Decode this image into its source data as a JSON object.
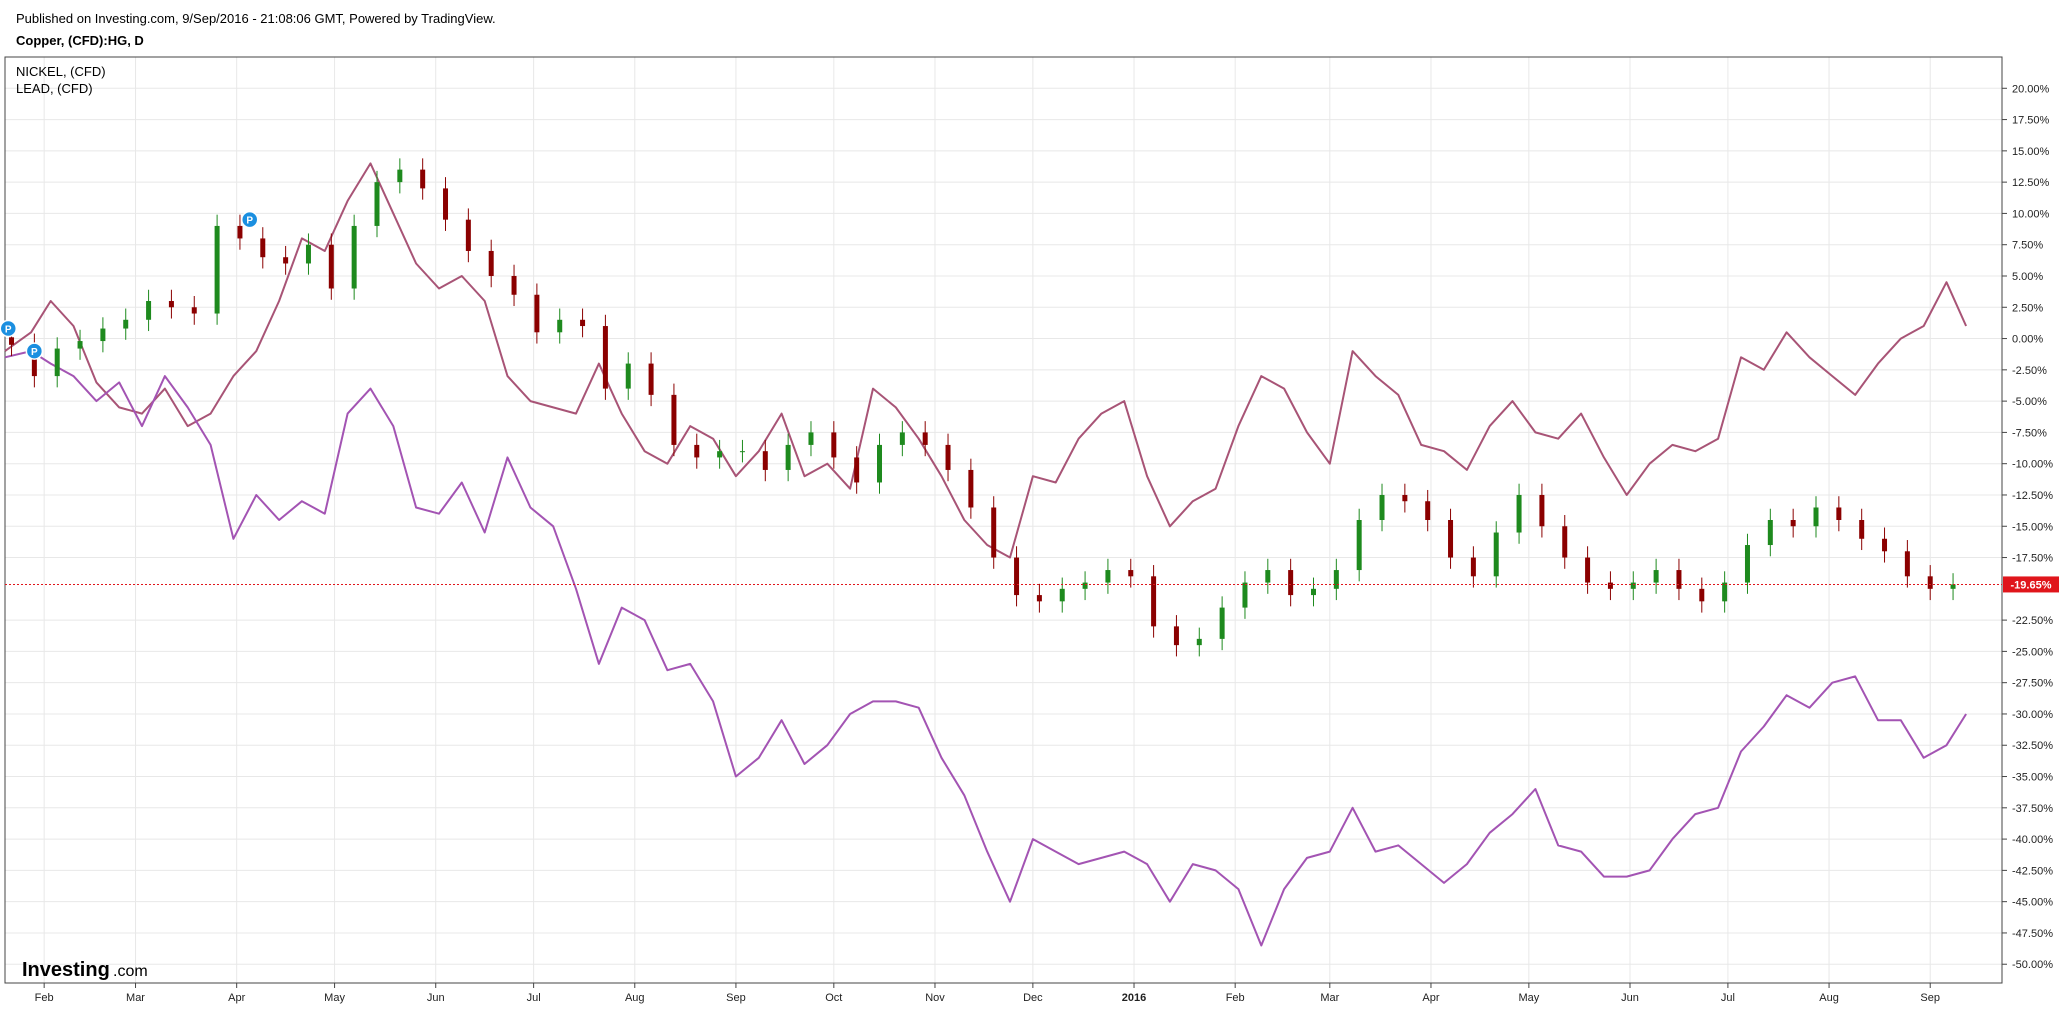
{
  "header": {
    "published": "Published on Investing.com, 9/Sep/2016 - 21:08:06 GMT, Powered by TradingView.",
    "symbol": "Copper, (CFD):HG, D"
  },
  "legend": [
    "NICKEL,  (CFD)",
    "LEAD,  (CFD)"
  ],
  "logo": {
    "main": "Investing",
    "suffix": ".com"
  },
  "markers": {
    "label": "P"
  },
  "colors": {
    "nickel": "#a85476",
    "lead": "#a354b3",
    "up": "#1e8a1e",
    "down": "#8b0000",
    "current": "#e0151b",
    "grid": "#e8e8e8"
  },
  "chart_data": {
    "type": "line",
    "ylim": [
      -51.5,
      22.5
    ],
    "y_ticks": [
      "20.00%",
      "17.50%",
      "15.00%",
      "12.50%",
      "10.00%",
      "7.50%",
      "5.00%",
      "2.50%",
      "0.00%",
      "-2.50%",
      "-5.00%",
      "-7.50%",
      "-10.00%",
      "-12.50%",
      "-15.00%",
      "-17.50%",
      "-22.50%",
      "-25.00%",
      "-27.50%",
      "-30.00%",
      "-32.50%",
      "-35.00%",
      "-37.50%",
      "-40.00%",
      "-42.50%",
      "-45.00%",
      "-47.50%",
      "-50.00%"
    ],
    "x_ticks": [
      "Feb",
      "Mar",
      "Apr",
      "May",
      "Jun",
      "Jul",
      "Aug",
      "Sep",
      "Oct",
      "Nov",
      "Dec",
      "2016",
      "Feb",
      "Mar",
      "Apr",
      "May",
      "Jun",
      "Jul",
      "Aug",
      "Sep"
    ],
    "current_value_label": "-19.65%",
    "current_value": -19.65,
    "x_range": [
      "2015-01-20",
      "2016-09-23"
    ],
    "series": [
      {
        "name": "Copper, (CFD):HG, D",
        "kind": "candles",
        "points": [
          [
            "2015-01-22",
            -0.5
          ],
          [
            "2015-01-29",
            -3.0
          ],
          [
            "2015-02-05",
            -0.8
          ],
          [
            "2015-02-12",
            -0.2
          ],
          [
            "2015-02-19",
            0.8
          ],
          [
            "2015-02-26",
            1.5
          ],
          [
            "2015-03-05",
            3.0
          ],
          [
            "2015-03-12",
            2.5
          ],
          [
            "2015-03-19",
            2.0
          ],
          [
            "2015-03-26",
            9.0
          ],
          [
            "2015-04-02",
            8.0
          ],
          [
            "2015-04-09",
            6.5
          ],
          [
            "2015-04-16",
            6.0
          ],
          [
            "2015-04-23",
            7.5
          ],
          [
            "2015-04-30",
            4.0
          ],
          [
            "2015-05-07",
            9.0
          ],
          [
            "2015-05-14",
            12.5
          ],
          [
            "2015-05-21",
            13.5
          ],
          [
            "2015-05-28",
            12.0
          ],
          [
            "2015-06-04",
            9.5
          ],
          [
            "2015-06-11",
            7.0
          ],
          [
            "2015-06-18",
            5.0
          ],
          [
            "2015-06-25",
            3.5
          ],
          [
            "2015-07-02",
            0.5
          ],
          [
            "2015-07-09",
            1.5
          ],
          [
            "2015-07-16",
            1.0
          ],
          [
            "2015-07-23",
            -4.0
          ],
          [
            "2015-07-30",
            -2.0
          ],
          [
            "2015-08-06",
            -4.5
          ],
          [
            "2015-08-13",
            -8.5
          ],
          [
            "2015-08-20",
            -9.5
          ],
          [
            "2015-08-27",
            -9.0
          ],
          [
            "2015-09-03",
            -9.0
          ],
          [
            "2015-09-10",
            -10.5
          ],
          [
            "2015-09-17",
            -8.5
          ],
          [
            "2015-09-24",
            -7.5
          ],
          [
            "2015-10-01",
            -9.5
          ],
          [
            "2015-10-08",
            -11.5
          ],
          [
            "2015-10-15",
            -8.5
          ],
          [
            "2015-10-22",
            -7.5
          ],
          [
            "2015-10-29",
            -8.5
          ],
          [
            "2015-11-05",
            -10.5
          ],
          [
            "2015-11-12",
            -13.5
          ],
          [
            "2015-11-19",
            -17.5
          ],
          [
            "2015-11-26",
            -20.5
          ],
          [
            "2015-12-03",
            -21.0
          ],
          [
            "2015-12-10",
            -20.0
          ],
          [
            "2015-12-17",
            -19.5
          ],
          [
            "2015-12-24",
            -18.5
          ],
          [
            "2015-12-31",
            -19.0
          ],
          [
            "2016-01-07",
            -23.0
          ],
          [
            "2016-01-14",
            -24.5
          ],
          [
            "2016-01-21",
            -24.0
          ],
          [
            "2016-01-28",
            -21.5
          ],
          [
            "2016-02-04",
            -19.5
          ],
          [
            "2016-02-11",
            -18.5
          ],
          [
            "2016-02-18",
            -20.5
          ],
          [
            "2016-02-25",
            -20.0
          ],
          [
            "2016-03-03",
            -18.5
          ],
          [
            "2016-03-10",
            -14.5
          ],
          [
            "2016-03-17",
            -12.5
          ],
          [
            "2016-03-24",
            -13.0
          ],
          [
            "2016-03-31",
            -14.5
          ],
          [
            "2016-04-07",
            -17.5
          ],
          [
            "2016-04-14",
            -19.0
          ],
          [
            "2016-04-21",
            -15.5
          ],
          [
            "2016-04-28",
            -12.5
          ],
          [
            "2016-05-05",
            -15.0
          ],
          [
            "2016-05-12",
            -17.5
          ],
          [
            "2016-05-19",
            -19.5
          ],
          [
            "2016-05-26",
            -20.0
          ],
          [
            "2016-06-02",
            -19.5
          ],
          [
            "2016-06-09",
            -18.5
          ],
          [
            "2016-06-16",
            -20.0
          ],
          [
            "2016-06-23",
            -21.0
          ],
          [
            "2016-06-30",
            -19.5
          ],
          [
            "2016-07-07",
            -16.5
          ],
          [
            "2016-07-14",
            -14.5
          ],
          [
            "2016-07-21",
            -15.0
          ],
          [
            "2016-07-28",
            -13.5
          ],
          [
            "2016-08-04",
            -14.5
          ],
          [
            "2016-08-11",
            -16.0
          ],
          [
            "2016-08-18",
            -17.0
          ],
          [
            "2016-08-25",
            -19.0
          ],
          [
            "2016-09-01",
            -20.0
          ],
          [
            "2016-09-08",
            -19.65
          ]
        ]
      },
      {
        "name": "NICKEL,  (CFD)",
        "kind": "line",
        "points": [
          [
            "2015-01-20",
            -1.0
          ],
          [
            "2015-01-28",
            0.5
          ],
          [
            "2015-02-03",
            3.0
          ],
          [
            "2015-02-10",
            1.0
          ],
          [
            "2015-02-17",
            -3.5
          ],
          [
            "2015-02-24",
            -5.5
          ],
          [
            "2015-03-03",
            -6.0
          ],
          [
            "2015-03-10",
            -4.0
          ],
          [
            "2015-03-17",
            -7.0
          ],
          [
            "2015-03-24",
            -6.0
          ],
          [
            "2015-03-31",
            -3.0
          ],
          [
            "2015-04-07",
            -1.0
          ],
          [
            "2015-04-14",
            3.0
          ],
          [
            "2015-04-21",
            8.0
          ],
          [
            "2015-04-28",
            7.0
          ],
          [
            "2015-05-05",
            11.0
          ],
          [
            "2015-05-12",
            14.0
          ],
          [
            "2015-05-19",
            10.0
          ],
          [
            "2015-05-26",
            6.0
          ],
          [
            "2015-06-02",
            4.0
          ],
          [
            "2015-06-09",
            5.0
          ],
          [
            "2015-06-16",
            3.0
          ],
          [
            "2015-06-23",
            -3.0
          ],
          [
            "2015-06-30",
            -5.0
          ],
          [
            "2015-07-07",
            -5.5
          ],
          [
            "2015-07-14",
            -6.0
          ],
          [
            "2015-07-21",
            -2.0
          ],
          [
            "2015-07-28",
            -6.0
          ],
          [
            "2015-08-04",
            -9.0
          ],
          [
            "2015-08-11",
            -10.0
          ],
          [
            "2015-08-18",
            -7.0
          ],
          [
            "2015-08-25",
            -8.0
          ],
          [
            "2015-09-01",
            -11.0
          ],
          [
            "2015-09-08",
            -9.0
          ],
          [
            "2015-09-15",
            -6.0
          ],
          [
            "2015-09-22",
            -11.0
          ],
          [
            "2015-09-29",
            -10.0
          ],
          [
            "2015-10-06",
            -12.0
          ],
          [
            "2015-10-13",
            -4.0
          ],
          [
            "2015-10-20",
            -5.5
          ],
          [
            "2015-10-27",
            -8.0
          ],
          [
            "2015-11-03",
            -11.0
          ],
          [
            "2015-11-10",
            -14.5
          ],
          [
            "2015-11-17",
            -16.5
          ],
          [
            "2015-11-24",
            -17.5
          ],
          [
            "2015-12-01",
            -11.0
          ],
          [
            "2015-12-08",
            -11.5
          ],
          [
            "2015-12-15",
            -8.0
          ],
          [
            "2015-12-22",
            -6.0
          ],
          [
            "2015-12-29",
            -5.0
          ],
          [
            "2016-01-05",
            -11.0
          ],
          [
            "2016-01-12",
            -15.0
          ],
          [
            "2016-01-19",
            -13.0
          ],
          [
            "2016-01-26",
            -12.0
          ],
          [
            "2016-02-02",
            -7.0
          ],
          [
            "2016-02-09",
            -3.0
          ],
          [
            "2016-02-16",
            -4.0
          ],
          [
            "2016-02-23",
            -7.5
          ],
          [
            "2016-03-01",
            -10.0
          ],
          [
            "2016-03-08",
            -1.0
          ],
          [
            "2016-03-15",
            -3.0
          ],
          [
            "2016-03-22",
            -4.5
          ],
          [
            "2016-03-29",
            -8.5
          ],
          [
            "2016-04-05",
            -9.0
          ],
          [
            "2016-04-12",
            -10.5
          ],
          [
            "2016-04-19",
            -7.0
          ],
          [
            "2016-04-26",
            -5.0
          ],
          [
            "2016-05-03",
            -7.5
          ],
          [
            "2016-05-10",
            -8.0
          ],
          [
            "2016-05-17",
            -6.0
          ],
          [
            "2016-05-24",
            -9.5
          ],
          [
            "2016-05-31",
            -12.5
          ],
          [
            "2016-06-07",
            -10.0
          ],
          [
            "2016-06-14",
            -8.5
          ],
          [
            "2016-06-21",
            -9.0
          ],
          [
            "2016-06-28",
            -8.0
          ],
          [
            "2016-07-05",
            -1.5
          ],
          [
            "2016-07-12",
            -2.5
          ],
          [
            "2016-07-19",
            0.5
          ],
          [
            "2016-07-26",
            -1.5
          ],
          [
            "2016-08-02",
            -3.0
          ],
          [
            "2016-08-09",
            -4.5
          ],
          [
            "2016-08-16",
            -2.0
          ],
          [
            "2016-08-23",
            0.0
          ],
          [
            "2016-08-30",
            1.0
          ],
          [
            "2016-09-06",
            4.5
          ],
          [
            "2016-09-12",
            1.0
          ]
        ]
      },
      {
        "name": "LEAD,  (CFD)",
        "kind": "line",
        "points": [
          [
            "2015-01-20",
            -1.5
          ],
          [
            "2015-01-28",
            -1.0
          ],
          [
            "2015-02-03",
            -2.0
          ],
          [
            "2015-02-10",
            -3.0
          ],
          [
            "2015-02-17",
            -5.0
          ],
          [
            "2015-02-24",
            -3.5
          ],
          [
            "2015-03-03",
            -7.0
          ],
          [
            "2015-03-10",
            -3.0
          ],
          [
            "2015-03-17",
            -5.5
          ],
          [
            "2015-03-24",
            -8.5
          ],
          [
            "2015-03-31",
            -16.0
          ],
          [
            "2015-04-07",
            -12.5
          ],
          [
            "2015-04-14",
            -14.5
          ],
          [
            "2015-04-21",
            -13.0
          ],
          [
            "2015-04-28",
            -14.0
          ],
          [
            "2015-05-05",
            -6.0
          ],
          [
            "2015-05-12",
            -4.0
          ],
          [
            "2015-05-19",
            -7.0
          ],
          [
            "2015-05-26",
            -13.5
          ],
          [
            "2015-06-02",
            -14.0
          ],
          [
            "2015-06-09",
            -11.5
          ],
          [
            "2015-06-16",
            -15.5
          ],
          [
            "2015-06-23",
            -9.5
          ],
          [
            "2015-06-30",
            -13.5
          ],
          [
            "2015-07-07",
            -15.0
          ],
          [
            "2015-07-14",
            -20.0
          ],
          [
            "2015-07-21",
            -26.0
          ],
          [
            "2015-07-28",
            -21.5
          ],
          [
            "2015-08-04",
            -22.5
          ],
          [
            "2015-08-11",
            -26.5
          ],
          [
            "2015-08-18",
            -26.0
          ],
          [
            "2015-08-25",
            -29.0
          ],
          [
            "2015-09-01",
            -35.0
          ],
          [
            "2015-09-08",
            -33.5
          ],
          [
            "2015-09-15",
            -30.5
          ],
          [
            "2015-09-22",
            -34.0
          ],
          [
            "2015-09-29",
            -32.5
          ],
          [
            "2015-10-06",
            -30.0
          ],
          [
            "2015-10-13",
            -29.0
          ],
          [
            "2015-10-20",
            -29.0
          ],
          [
            "2015-10-27",
            -29.5
          ],
          [
            "2015-11-03",
            -33.5
          ],
          [
            "2015-11-10",
            -36.5
          ],
          [
            "2015-11-17",
            -41.0
          ],
          [
            "2015-11-24",
            -45.0
          ],
          [
            "2015-12-01",
            -40.0
          ],
          [
            "2015-12-08",
            -41.0
          ],
          [
            "2015-12-15",
            -42.0
          ],
          [
            "2015-12-22",
            -41.5
          ],
          [
            "2015-12-29",
            -41.0
          ],
          [
            "2016-01-05",
            -42.0
          ],
          [
            "2016-01-12",
            -45.0
          ],
          [
            "2016-01-19",
            -42.0
          ],
          [
            "2016-01-26",
            -42.5
          ],
          [
            "2016-02-02",
            -44.0
          ],
          [
            "2016-02-09",
            -48.5
          ],
          [
            "2016-02-16",
            -44.0
          ],
          [
            "2016-02-23",
            -41.5
          ],
          [
            "2016-03-01",
            -41.0
          ],
          [
            "2016-03-08",
            -37.5
          ],
          [
            "2016-03-15",
            -41.0
          ],
          [
            "2016-03-22",
            -40.5
          ],
          [
            "2016-03-29",
            -42.0
          ],
          [
            "2016-04-05",
            -43.5
          ],
          [
            "2016-04-12",
            -42.0
          ],
          [
            "2016-04-19",
            -39.5
          ],
          [
            "2016-04-26",
            -38.0
          ],
          [
            "2016-05-03",
            -36.0
          ],
          [
            "2016-05-10",
            -40.5
          ],
          [
            "2016-05-17",
            -41.0
          ],
          [
            "2016-05-24",
            -43.0
          ],
          [
            "2016-05-31",
            -43.0
          ],
          [
            "2016-06-07",
            -42.5
          ],
          [
            "2016-06-14",
            -40.0
          ],
          [
            "2016-06-21",
            -38.0
          ],
          [
            "2016-06-28",
            -37.5
          ],
          [
            "2016-07-05",
            -33.0
          ],
          [
            "2016-07-12",
            -31.0
          ],
          [
            "2016-07-19",
            -28.5
          ],
          [
            "2016-07-26",
            -29.5
          ],
          [
            "2016-08-02",
            -27.5
          ],
          [
            "2016-08-09",
            -27.0
          ],
          [
            "2016-08-16",
            -30.5
          ],
          [
            "2016-08-23",
            -30.5
          ],
          [
            "2016-08-30",
            -33.5
          ],
          [
            "2016-09-06",
            -32.5
          ],
          [
            "2016-09-12",
            -30.0
          ]
        ]
      }
    ]
  }
}
